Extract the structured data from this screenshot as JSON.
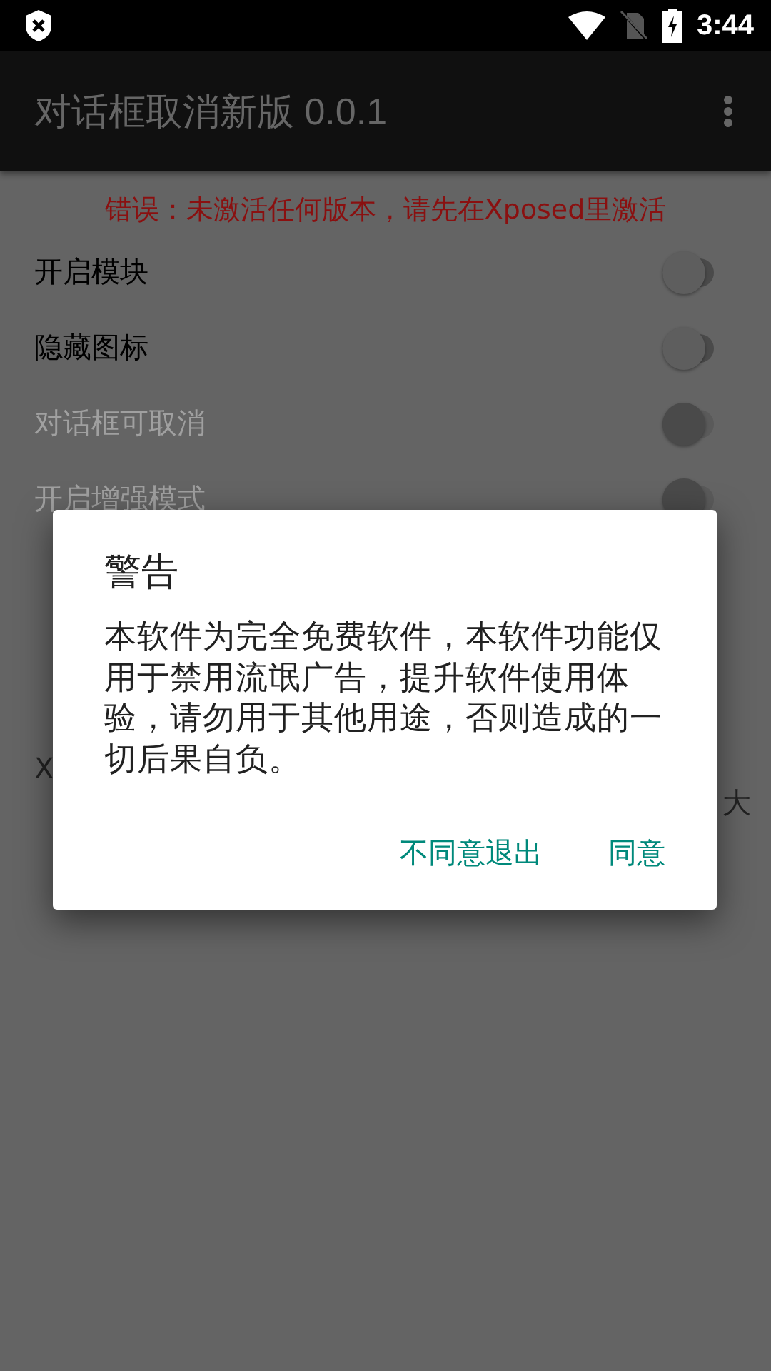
{
  "status_bar": {
    "time": "3:44"
  },
  "app_bar": {
    "title": "对话框取消新版 0.0.1"
  },
  "error_message": "错误：未激活任何版本，请先在Xposed里激活",
  "settings": [
    {
      "label": "开启模块",
      "on": false,
      "disabled": false
    },
    {
      "label": "隐藏图标",
      "on": false,
      "disabled": false
    },
    {
      "label": "对话框可取消",
      "on": false,
      "disabled": true
    },
    {
      "label": "开启增强模式",
      "on": false,
      "disabled": true
    }
  ],
  "covered_text": {
    "left_lines": [
      "X"
    ],
    "right_line": "大"
  },
  "dialog": {
    "title": "警告",
    "message": "本软件为完全免费软件，本软件功能仅用于禁用流氓广告，提升软件使用体验，请勿用于其他用途，否则造成的一切后果自负。",
    "buttons": [
      "不同意退出",
      "同意"
    ]
  }
}
